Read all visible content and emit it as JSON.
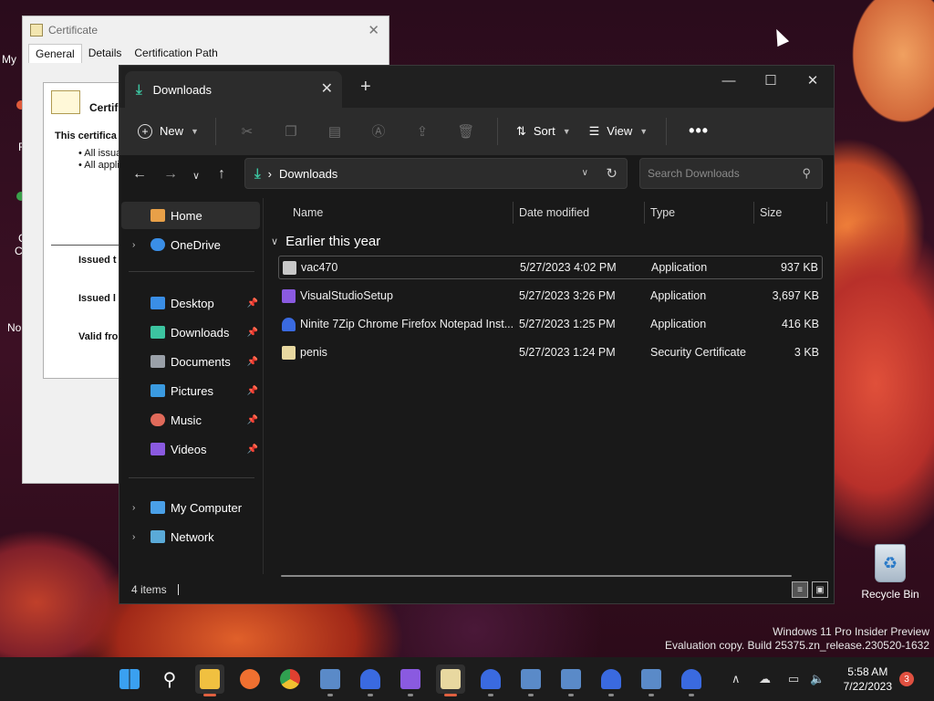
{
  "certificate": {
    "title": "Certificate",
    "tabs": [
      "General",
      "Details",
      "Certification Path"
    ],
    "heading": "Certifi",
    "purpose": "This certifica",
    "bullet1": "• All issua",
    "bullet2": "• All appli",
    "issued_to": "Issued t",
    "issued_by": "Issued l",
    "valid_from": "Valid fro"
  },
  "desktop": {
    "left_labels": [
      "My",
      "F",
      "C",
      "C",
      "No"
    ],
    "recycle_bin": "Recycle Bin",
    "watermark_line1": "Windows 11 Pro Insider Preview",
    "watermark_line2": "Evaluation copy. Build 25375.zn_release.230520-1632"
  },
  "explorer": {
    "tab_title": "Downloads",
    "toolbar": {
      "new": "New",
      "sort": "Sort",
      "view": "View",
      "more": "•••"
    },
    "address": {
      "path": "Downloads",
      "search_placeholder": "Search Downloads"
    },
    "sidebar": {
      "home": "Home",
      "onedrive": "OneDrive",
      "quick": [
        {
          "label": "Desktop",
          "color": "#3a8ee6"
        },
        {
          "label": "Downloads",
          "color": "#3cc4a0"
        },
        {
          "label": "Documents",
          "color": "#9aa0a8"
        },
        {
          "label": "Pictures",
          "color": "#3a9ae0"
        },
        {
          "label": "Music",
          "color": "#e06a5a"
        },
        {
          "label": "Videos",
          "color": "#8a5ae0"
        }
      ],
      "my_computer": "My Computer",
      "network": "Network"
    },
    "columns": {
      "name": "Name",
      "date": "Date modified",
      "type": "Type",
      "size": "Size"
    },
    "group": "Earlier this year",
    "files": [
      {
        "name": "vac470",
        "date": "5/27/2023 4:02 PM",
        "type": "Application",
        "size": "937 KB",
        "color": "#c8c8c8"
      },
      {
        "name": "VisualStudioSetup",
        "date": "5/27/2023 3:26 PM",
        "type": "Application",
        "size": "3,697 KB",
        "color": "#8a5ae0"
      },
      {
        "name": "Ninite 7Zip Chrome Firefox Notepad Inst...",
        "date": "5/27/2023 1:25 PM",
        "type": "Application",
        "size": "416 KB",
        "color": "#3a6ae0"
      },
      {
        "name": "penis",
        "date": "5/27/2023 1:24 PM",
        "type": "Security Certificate",
        "size": "3 KB",
        "color": "#e8d8a0"
      }
    ],
    "status": "4 items"
  },
  "taskbar": {
    "time": "5:58 AM",
    "date": "7/22/2023",
    "notifications": "3"
  }
}
